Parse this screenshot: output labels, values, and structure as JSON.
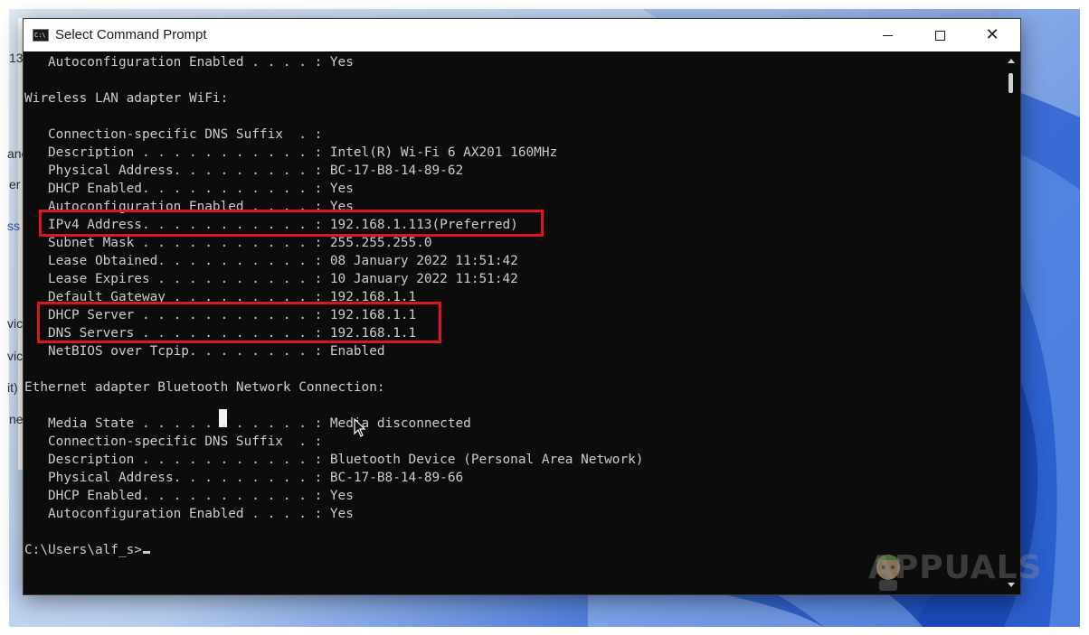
{
  "window": {
    "title": "Select Command Prompt",
    "icon": "cmd-icon",
    "controls": {
      "minimize": "minimize-icon",
      "maximize": "maximize-icon",
      "close": "✕"
    }
  },
  "terminal": {
    "lines": [
      "   Autoconfiguration Enabled . . . . : Yes",
      "",
      "Wireless LAN adapter WiFi:",
      "",
      "   Connection-specific DNS Suffix  . :",
      "   Description . . . . . . . . . . . : Intel(R) Wi-Fi 6 AX201 160MHz",
      "   Physical Address. . . . . . . . . : BC-17-B8-14-89-62",
      "   DHCP Enabled. . . . . . . . . . . : Yes",
      "   Autoconfiguration Enabled . . . . : Yes",
      "   IPv4 Address. . . . . . . . . . . : 192.168.1.113(Preferred)",
      "   Subnet Mask . . . . . . . . . . . : 255.255.255.0",
      "   Lease Obtained. . . . . . . . . . : 08 January 2022 11:51:42",
      "   Lease Expires . . . . . . . . . . : 10 January 2022 11:51:42",
      "   Default Gateway . . . . . . . . . : 192.168.1.1",
      "   DHCP Server . . . . . . . . . . . : 192.168.1.1",
      "   DNS Servers . . . . . . . . . . . : 192.168.1.1",
      "   NetBIOS over Tcpip. . . . . . . . : Enabled",
      "",
      "Ethernet adapter Bluetooth Network Connection:",
      "",
      "   Media State . . . . . . . . . . . : Media disconnected",
      "   Connection-specific DNS Suffix  . :",
      "   Description . . . . . . . . . . . : Bluetooth Device (Personal Area Network)",
      "   Physical Address. . . . . . . . . : BC-17-B8-14-89-66",
      "   DHCP Enabled. . . . . . . . . . . : Yes",
      "   Autoconfiguration Enabled . . . . : Yes",
      "",
      "C:\\Users\\alf_s>"
    ]
  },
  "background_window": {
    "fragments": [
      "13",
      "and",
      "er",
      "ss",
      "vic",
      "vic",
      "it)",
      "ne"
    ]
  },
  "highlight_color": "#e0141c",
  "watermark": {
    "text": "APPUALS"
  }
}
